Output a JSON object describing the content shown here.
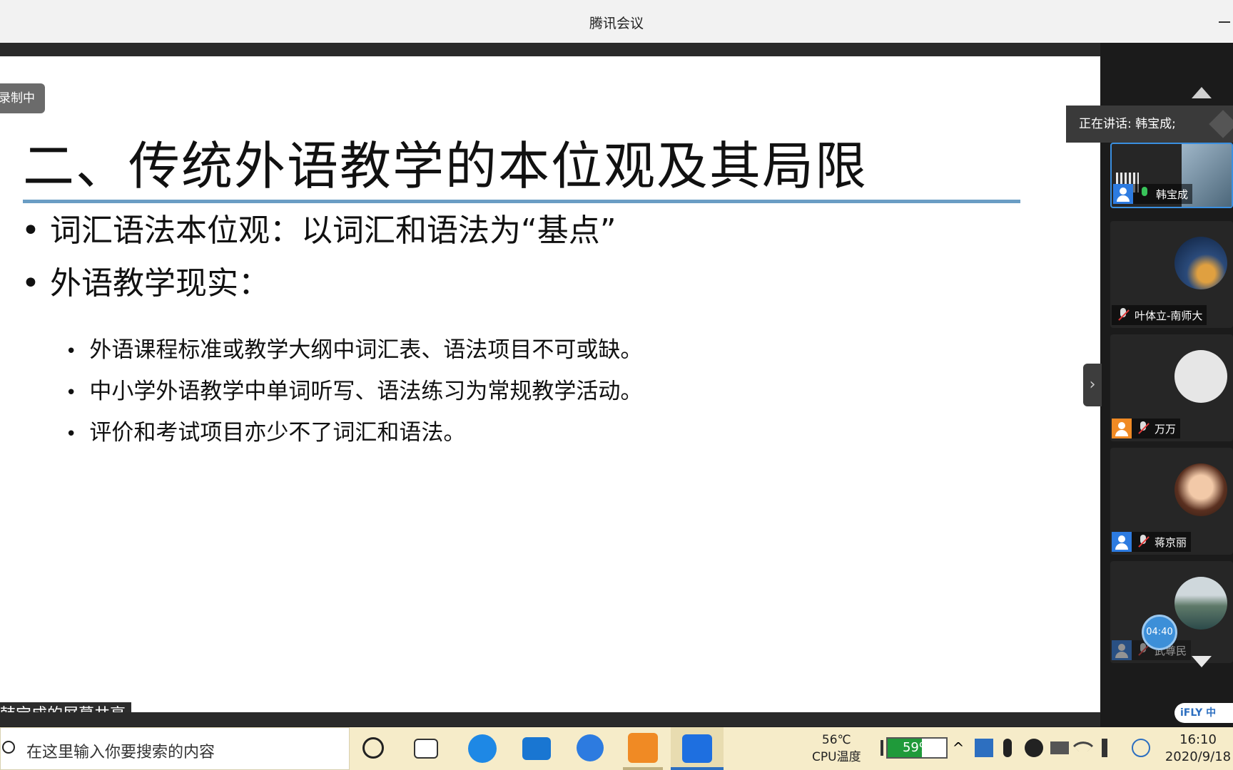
{
  "window": {
    "title": "腾讯会议"
  },
  "recording_badge": "录制中",
  "slide": {
    "title": "二、传统外语教学的本位观及其局限",
    "bullets": [
      {
        "text": "词汇语法本位观：以词汇和语法为“基点”"
      },
      {
        "text": "外语教学现实："
      }
    ],
    "sub_bullets": [
      "外语课程标准或教学大纲中词汇表、语法项目不可或缺。",
      "中小学外语教学中单词听写、语法练习为常规教学活动。",
      "评价和考试项目亦少不了词汇和语法。"
    ]
  },
  "share_label": "韩宝成的屏幕共享",
  "speaking": "正在讲话: 韩宝成;",
  "participants": [
    {
      "name": "韩宝成",
      "mic": "on",
      "active": true
    },
    {
      "name": "叶体立-南师大",
      "mic": "muted",
      "active": false
    },
    {
      "name": "万万",
      "mic": "muted",
      "active": false
    },
    {
      "name": "蒋京丽",
      "mic": "muted",
      "active": false
    },
    {
      "name": "武尊民",
      "mic": "muted",
      "active": false
    }
  ],
  "timer": "04:40",
  "ifly": "iFLY 中",
  "taskbar": {
    "search_placeholder": "在这里输入你要搜索的内容",
    "cpu_temp": "56℃",
    "cpu_label": "CPU温度",
    "battery": "59%",
    "battery_level": 0.59,
    "time": "16:10",
    "date": "2020/9/18"
  },
  "colors": {
    "title_rule": "#6a9dc4",
    "active_border": "#3a8fe0",
    "mic_on": "#38c35a",
    "mic_muted": "#e23a3a",
    "battery_fill": "#1f9a3a"
  }
}
